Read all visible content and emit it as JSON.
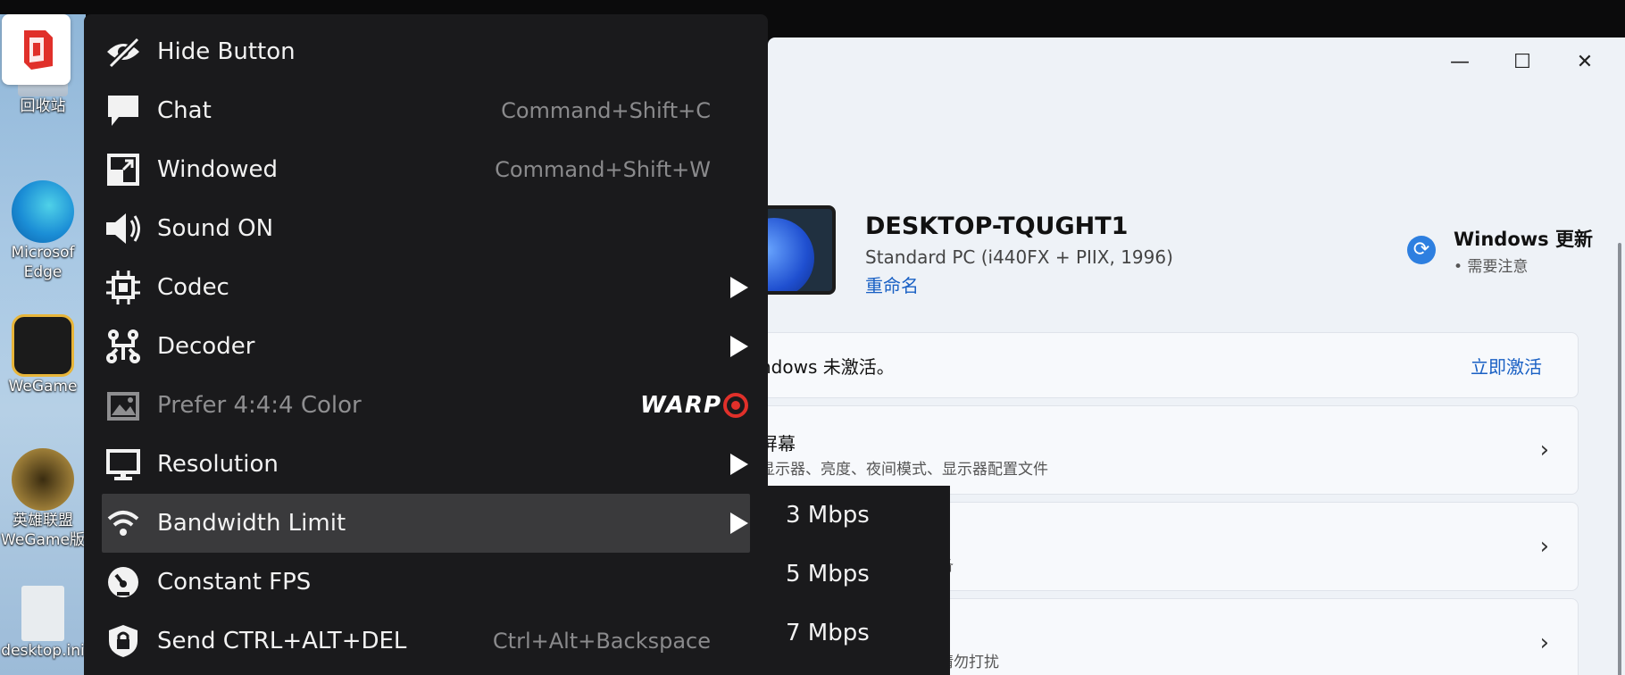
{
  "desktop": {
    "icons": [
      {
        "label": "回收站"
      },
      {
        "label": "Microsoft Edge",
        "label_line1": "Microsof",
        "label_line2": "Edge"
      },
      {
        "label": "WeGame"
      },
      {
        "label_line1": "英雄联盟",
        "label_line2": "WeGame版"
      },
      {
        "label": "desktop.ini"
      }
    ]
  },
  "settings_window": {
    "controls": {
      "minimize": "—",
      "maximize": "☐",
      "close": "✕"
    },
    "device_name": "DESKTOP-TQUGHT1",
    "device_desc": "Standard PC (i440FX + PIIX, 1996)",
    "rename_link": "重命名",
    "update_title": "Windows 更新",
    "update_sub": "• 需要注意",
    "activation_text": "ndows 未激活。",
    "activation_link": "立即激活",
    "rows": [
      {
        "title": "屏幕",
        "sub": "显示器、亮度、夜间模式、显示器配置文件"
      },
      {
        "title": "",
        "sub": "备"
      },
      {
        "title": "",
        "sub": "请勿打扰"
      }
    ]
  },
  "menu": {
    "items": [
      {
        "label": "Hide Button",
        "shortcut": "",
        "icon": "eye-off-icon"
      },
      {
        "label": "Chat",
        "shortcut": "Command+Shift+C",
        "icon": "chat-icon"
      },
      {
        "label": "Windowed",
        "shortcut": "Command+Shift+W",
        "icon": "windowed-icon"
      },
      {
        "label": "Sound ON",
        "shortcut": "",
        "icon": "speaker-icon"
      },
      {
        "label": "Codec",
        "shortcut": "",
        "icon": "chip-icon",
        "submenu": true
      },
      {
        "label": "Decoder",
        "shortcut": "",
        "icon": "decoder-icon",
        "submenu": true
      },
      {
        "label": "Prefer 4:4:4 Color",
        "shortcut": "",
        "icon": "image-icon",
        "disabled": true,
        "badge": "WARP"
      },
      {
        "label": "Resolution",
        "shortcut": "",
        "icon": "monitor-icon",
        "submenu": true
      },
      {
        "label": "Bandwidth Limit",
        "shortcut": "",
        "icon": "wifi-icon",
        "submenu": true,
        "active": true
      },
      {
        "label": "Constant FPS",
        "shortcut": "",
        "icon": "gauge-icon"
      },
      {
        "label": "Send CTRL+ALT+DEL",
        "shortcut": "Ctrl+Alt+Backspace",
        "icon": "lock-shield-icon"
      }
    ]
  },
  "submenu": {
    "items": [
      "3 Mbps",
      "5 Mbps",
      "7 Mbps"
    ]
  },
  "colors": {
    "menu_bg": "#1a1a1c",
    "menu_active": "#3a3a3c",
    "accent_red": "#e0302a",
    "link_blue": "#1960c4"
  }
}
